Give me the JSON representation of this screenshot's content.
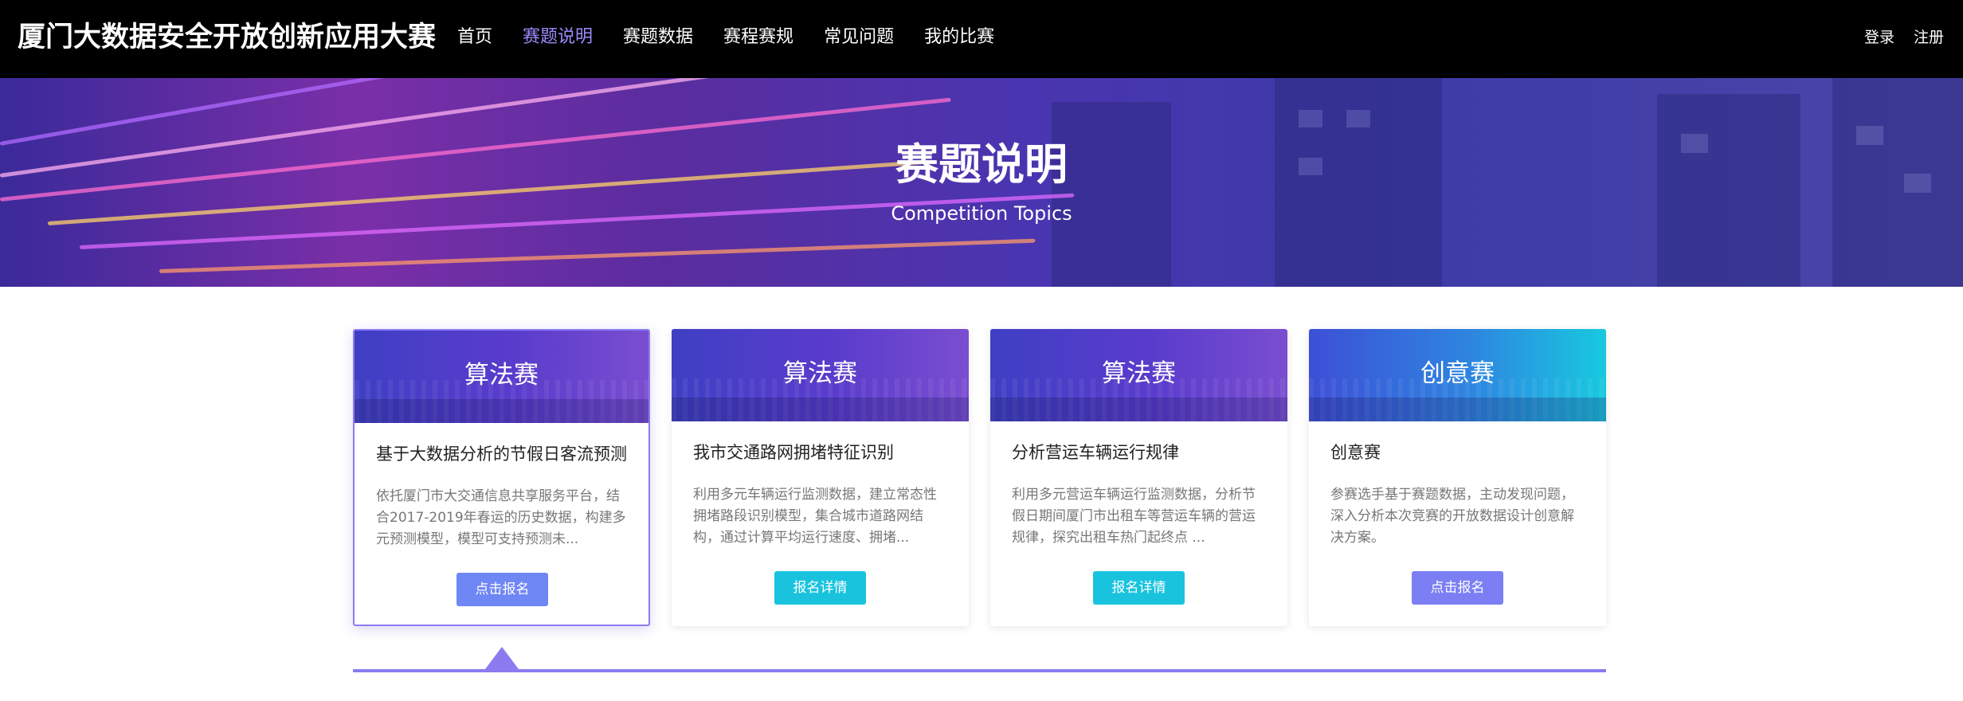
{
  "header": {
    "brand": "厦门大数据安全开放创新应用大赛",
    "nav": [
      {
        "label": "首页",
        "active": false
      },
      {
        "label": "赛题说明",
        "active": true
      },
      {
        "label": "赛题数据",
        "active": false
      },
      {
        "label": "赛程赛规",
        "active": false
      },
      {
        "label": "常见问题",
        "active": false
      },
      {
        "label": "我的比赛",
        "active": false
      }
    ],
    "login": "登录",
    "register": "注册"
  },
  "banner": {
    "title": "赛题说明",
    "subtitle": "Competition Topics"
  },
  "cards": [
    {
      "type": "算法赛",
      "title": "基于大数据分析的节假日客流预测",
      "desc": "依托厦门市大交通信息共享服务平台，结合2017-2019年春运的历史数据，构建多元预测模型，模型可支持预测未...",
      "button": "点击报名"
    },
    {
      "type": "算法赛",
      "title": "我市交通路网拥堵特征识别",
      "desc": "利用多元车辆运行监测数据，建立常态性拥堵路段识别模型，集合城市道路网结构，通过计算平均运行速度、拥堵...",
      "button": "报名详情"
    },
    {
      "type": "算法赛",
      "title": "分析营运车辆运行规律",
      "desc": "利用多元营运车辆运行监测数据，分析节假日期间厦门市出租车等营运车辆的营运规律，探究出租车热门起终点 ...",
      "button": "报名详情"
    },
    {
      "type": "创意赛",
      "title": "创意赛",
      "desc": "参赛选手基于赛题数据，主动发现问题，深入分析本次竞赛的开放数据设计创意解决方案。",
      "button": "点击报名"
    }
  ],
  "colors": {
    "accent": "#8a7cf0",
    "nav_active": "#9b8cff",
    "button_blue": "#6f86f5",
    "button_cyan": "#19c3de"
  }
}
